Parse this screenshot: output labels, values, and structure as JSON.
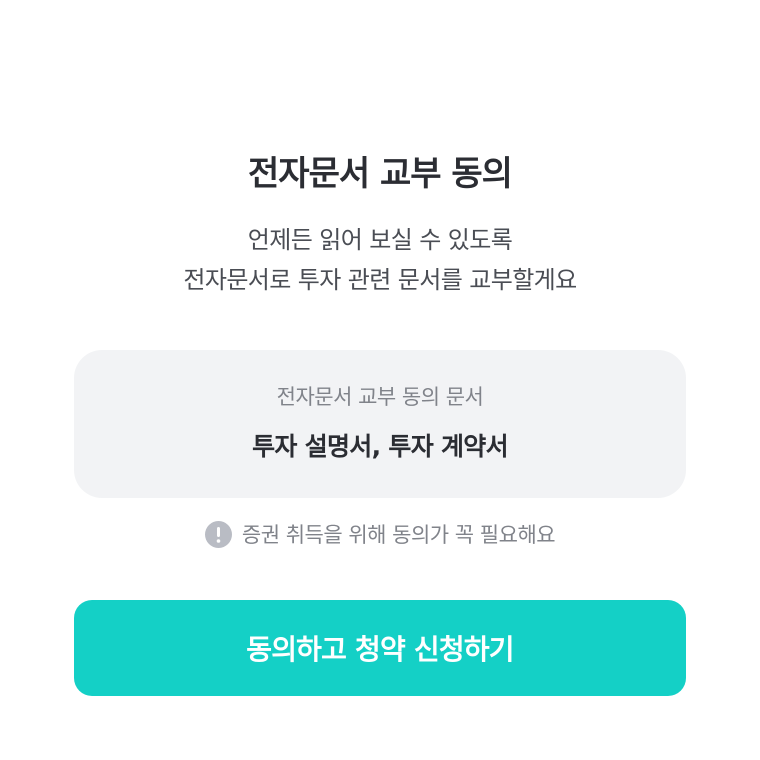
{
  "header": {
    "title": "전자문서 교부 동의",
    "subtitle_lines": [
      "언제든 읽어 보실 수 있도록",
      "전자문서로 투자 관련 문서를 교부할게요"
    ]
  },
  "document_card": {
    "label": "전자문서 교부 동의 문서",
    "value": "투자 설명서, 투자 계약서"
  },
  "notice": {
    "icon": "exclamation-circle-icon",
    "text": "증권 취득을 위해 동의가 꼭 필요해요"
  },
  "cta": {
    "label": "동의하고 청약 신청하기",
    "color": "#14d0c6"
  },
  "colors": {
    "background": "#ffffff",
    "card_background": "#f2f3f5",
    "notice_icon": "#b9bcc4",
    "primary_text": "#2b2d33",
    "secondary_text": "#80838a"
  }
}
